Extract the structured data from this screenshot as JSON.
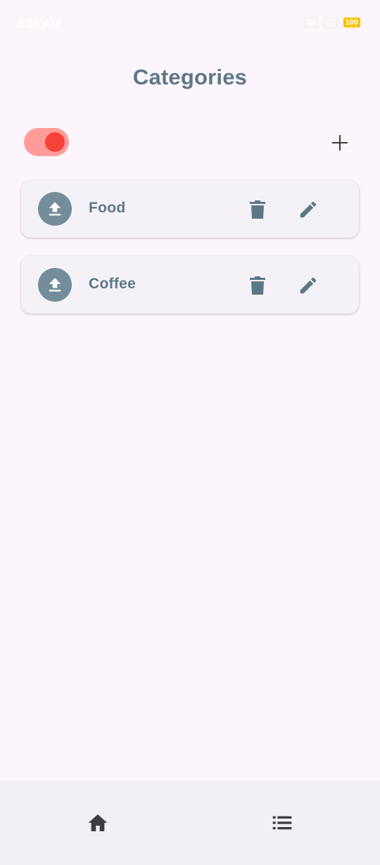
{
  "status_bar": {
    "time": "3:28 AM",
    "battery": "100"
  },
  "header": {
    "title": "Categories"
  },
  "toolbar": {
    "toggle_on": true,
    "toggle_icon": "toggle-switch-icon",
    "add_icon": "plus-icon"
  },
  "categories": [
    {
      "label": "Food",
      "icon": "upload-icon"
    },
    {
      "label": "Coffee",
      "icon": "upload-icon"
    }
  ],
  "bottom_nav": {
    "items": [
      {
        "icon": "home-icon"
      },
      {
        "icon": "list-icon"
      }
    ]
  },
  "colors": {
    "background": "#fcf5fc",
    "title": "#5e7786",
    "toggle_track": "#ff9c99",
    "toggle_knob": "#f5433a",
    "card": "#f5f2f7",
    "avatar": "#748d9b",
    "nav_background": "#f2eff5",
    "battery": "#f5c400"
  }
}
